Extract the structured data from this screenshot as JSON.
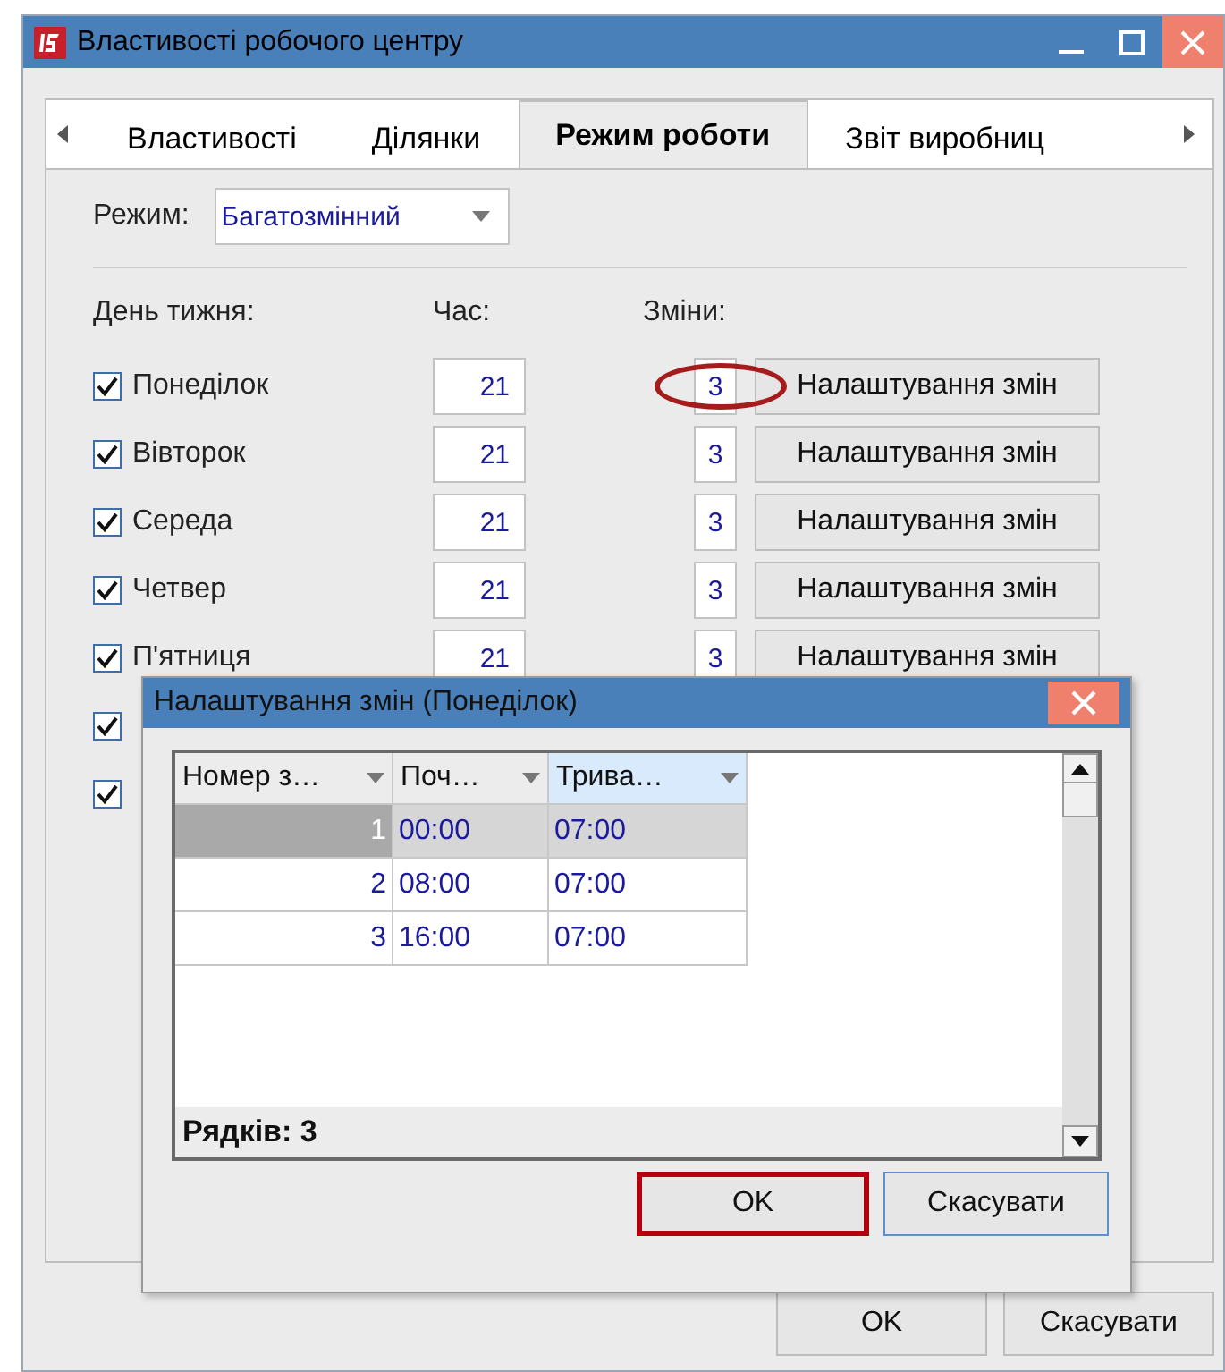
{
  "window": {
    "title": "Властивості робочого центру"
  },
  "tabs": [
    {
      "label": "Властивості",
      "selected": false
    },
    {
      "label": "Ділянки",
      "selected": false
    },
    {
      "label": "Режим роботи",
      "selected": true
    },
    {
      "label": "Звіт виробниц",
      "selected": false
    }
  ],
  "mode": {
    "label": "Режим:",
    "value": "Багатозмінний"
  },
  "schedule": {
    "headers": [
      "День тижня:",
      "Час:",
      "Зміни:"
    ],
    "days": [
      {
        "name": "Понеділок",
        "checked": true,
        "hours": "21",
        "shifts": "3",
        "highlighted": true,
        "button": "Налаштування змін"
      },
      {
        "name": "Вівторок",
        "checked": true,
        "hours": "21",
        "shifts": "3",
        "highlighted": false,
        "button": "Налаштування змін"
      },
      {
        "name": "Середа",
        "checked": true,
        "hours": "21",
        "shifts": "3",
        "highlighted": false,
        "button": "Налаштування змін"
      },
      {
        "name": "Четвер",
        "checked": true,
        "hours": "21",
        "shifts": "3",
        "highlighted": false,
        "button": "Налаштування змін"
      },
      {
        "name": "П'ятниця",
        "checked": true,
        "hours": "21",
        "shifts": "3",
        "highlighted": false,
        "button": "Налаштування змін"
      },
      {
        "checked": true
      },
      {
        "checked": true
      }
    ]
  },
  "dialog": {
    "title": "Налаштування змін (Понеділок)",
    "columns": [
      {
        "label": "Номер з…",
        "sorted": false
      },
      {
        "label": "Поч…",
        "sorted": false
      },
      {
        "label": "Трива…",
        "sorted": true
      }
    ],
    "rows": [
      {
        "number": "1",
        "start": "00:00",
        "duration": "07:00",
        "selected": true
      },
      {
        "number": "2",
        "start": "08:00",
        "duration": "07:00",
        "selected": false
      },
      {
        "number": "3",
        "start": "16:00",
        "duration": "07:00",
        "selected": false
      }
    ],
    "footer": "Рядків: 3",
    "buttons": [
      {
        "label": "OK",
        "highlighted": true
      },
      {
        "label": "Скасувати",
        "highlighted": false
      }
    ]
  },
  "buttons": [
    "OK",
    "Скасувати"
  ]
}
